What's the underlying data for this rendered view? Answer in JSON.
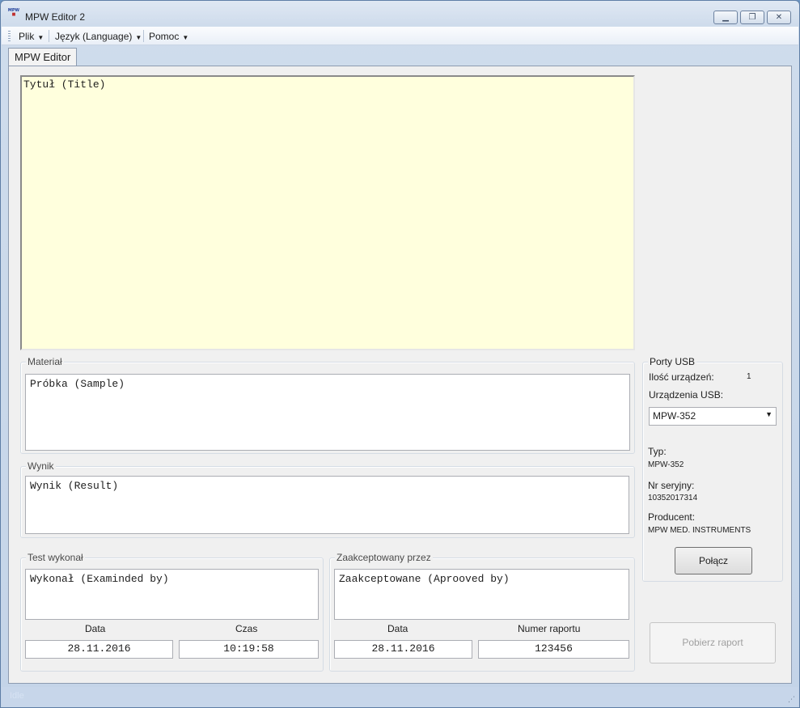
{
  "window": {
    "title": "MPW Editor 2",
    "icon_text": "MPW",
    "buttons": {
      "minimize": "▁",
      "restore": "❐",
      "close": "✕"
    }
  },
  "menu": {
    "items": [
      {
        "label": "Plik",
        "caret": "▼"
      },
      {
        "label": "Język (Language)",
        "caret": "▼"
      },
      {
        "label": "Pomoc",
        "caret": "▼"
      }
    ]
  },
  "tabs": [
    {
      "label": "MPW Editor"
    }
  ],
  "title_area": {
    "value": "Tytuł (Title)"
  },
  "material": {
    "label": "Materiał",
    "value": "Próbka (Sample)"
  },
  "result": {
    "label": "Wynik",
    "value": "Wynik (Result)"
  },
  "examined": {
    "label": "Test wykonał",
    "value": "Wykonał (Examinded by)",
    "date_label": "Data",
    "time_label": "Czas",
    "date": "28.11.2016",
    "time": "10:19:58"
  },
  "accepted": {
    "label": "Zaakceptowany przez",
    "value": "Zaakceptowane (Aprooved by)",
    "date_label": "Data",
    "report_label": "Numer raportu",
    "date": "28.11.2016",
    "report_number": "123456"
  },
  "usb": {
    "label": "Porty USB",
    "count_label": "Ilość urządzeń:",
    "count": "1",
    "devices_label": "Urządzenia USB:",
    "selected_device": "MPW-352",
    "type_label": "Typ:",
    "type": "MPW-352",
    "serial_label": "Nr seryjny:",
    "serial": "10352017314",
    "producer_label": "Producent:",
    "producer": "MPW MED. INSTRUMENTS",
    "connect_button": "Połącz"
  },
  "report_button": "Pobierz raport",
  "status": {
    "text": "Idle"
  },
  "colors": {
    "title_area_bg": "#ffffdd",
    "panel_bg": "#f0f0f0",
    "window_frame": "#c4d4e8"
  }
}
